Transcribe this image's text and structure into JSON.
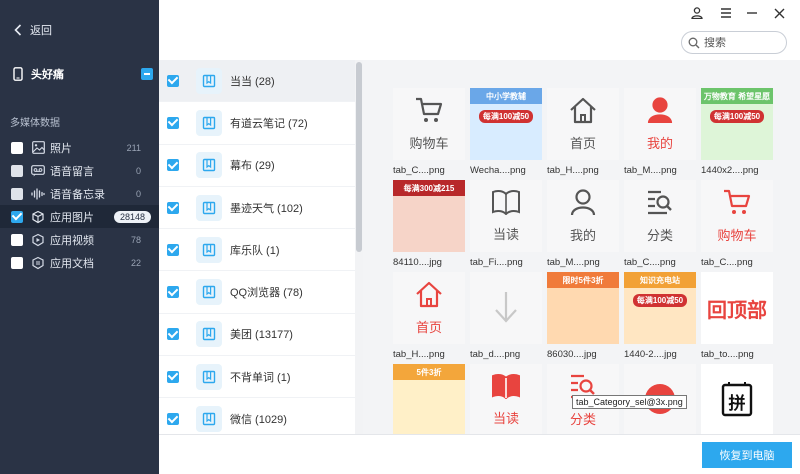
{
  "sidebar": {
    "back_label": "返回",
    "device_name": "头好痛",
    "section_title": "多媒体数据",
    "categories": [
      {
        "label": "照片",
        "count": "211",
        "checked": false,
        "icon": "photo-icon"
      },
      {
        "label": "语音留言",
        "count": "0",
        "checked": false,
        "icon": "voicemail-icon"
      },
      {
        "label": "语音备忘录",
        "count": "0",
        "checked": false,
        "icon": "voice-memo-icon"
      },
      {
        "label": "应用图片",
        "count": "28148",
        "checked": true,
        "icon": "app-images-icon"
      },
      {
        "label": "应用视频",
        "count": "78",
        "checked": false,
        "icon": "app-video-icon"
      },
      {
        "label": "应用文档",
        "count": "22",
        "checked": false,
        "icon": "app-docs-icon"
      }
    ]
  },
  "search": {
    "placeholder": "搜索"
  },
  "apps": [
    {
      "label": "当当 (28)"
    },
    {
      "label": "有道云笔记 (72)"
    },
    {
      "label": "幕布 (29)"
    },
    {
      "label": "墨迹天气 (102)"
    },
    {
      "label": "库乐队 (1)"
    },
    {
      "label": "QQ浏览器 (78)"
    },
    {
      "label": "美团 (13177)"
    },
    {
      "label": "不背单词 (1)"
    },
    {
      "label": "微信 (1029)"
    }
  ],
  "images": [
    {
      "name": "tab_C....png",
      "icon": "cart-icon",
      "text": "购物车",
      "style": "gray"
    },
    {
      "name": "Wecha....png",
      "icon": "promo-image",
      "text": "中小学教辅",
      "badge": "每满100减50",
      "style": "promo-blue"
    },
    {
      "name": "tab_H....png",
      "icon": "home-icon",
      "text": "首页",
      "style": "gray"
    },
    {
      "name": "tab_M....png",
      "icon": "user-icon",
      "text": "我的",
      "style": "red"
    },
    {
      "name": "1440x2....png",
      "icon": "promo-image",
      "text": "万物教育 希望星愿",
      "badge": "每满100减50",
      "style": "promo-green"
    },
    {
      "name": "84110....jpg",
      "icon": "promo-image",
      "text": "每满300减215",
      "style": "promo-red"
    },
    {
      "name": "tab_Fi....png",
      "icon": "book-icon",
      "text": "当读",
      "style": "gray"
    },
    {
      "name": "tab_M....png",
      "icon": "user-icon",
      "text": "我的",
      "style": "gray"
    },
    {
      "name": "tab_C....png",
      "icon": "category-icon",
      "text": "分类",
      "style": "gray"
    },
    {
      "name": "tab_C....png",
      "icon": "cart-icon",
      "text": "购物车",
      "style": "red"
    },
    {
      "name": "tab_H....png",
      "icon": "home-icon",
      "text": "首页",
      "style": "red"
    },
    {
      "name": "tab_d....png",
      "icon": "down-arrow-icon",
      "text": "",
      "style": "gray"
    },
    {
      "name": "86030....jpg",
      "icon": "promo-image",
      "text": "限时5件3折",
      "style": "promo-orange"
    },
    {
      "name": "1440-2....jpg",
      "icon": "promo-image",
      "text": "知识充电站",
      "badge": "每满100减50",
      "style": "promo-orange2"
    },
    {
      "name": "tab_to....png",
      "icon": "text-image",
      "text": "回顶部",
      "style": "red-text"
    },
    {
      "name": "",
      "icon": "promo-image",
      "text": "5件3折",
      "style": "promo-yellow"
    },
    {
      "name": "",
      "icon": "book-icon",
      "text": "当读",
      "style": "red"
    },
    {
      "name": "",
      "icon": "category-icon",
      "text": "分类",
      "style": "red"
    },
    {
      "name": "",
      "icon": "red-circle",
      "text": "",
      "style": "red"
    },
    {
      "name": "",
      "icon": "pinyin-icon",
      "text": "拼",
      "style": "white"
    }
  ],
  "tooltip": "tab_Category_sel@3x.png",
  "bottom": {
    "restore_label": "恢复到电脑"
  },
  "colors": {
    "accent": "#2da8ee",
    "sidebar_bg": "#2a3345",
    "brand_red": "#e8443f"
  }
}
